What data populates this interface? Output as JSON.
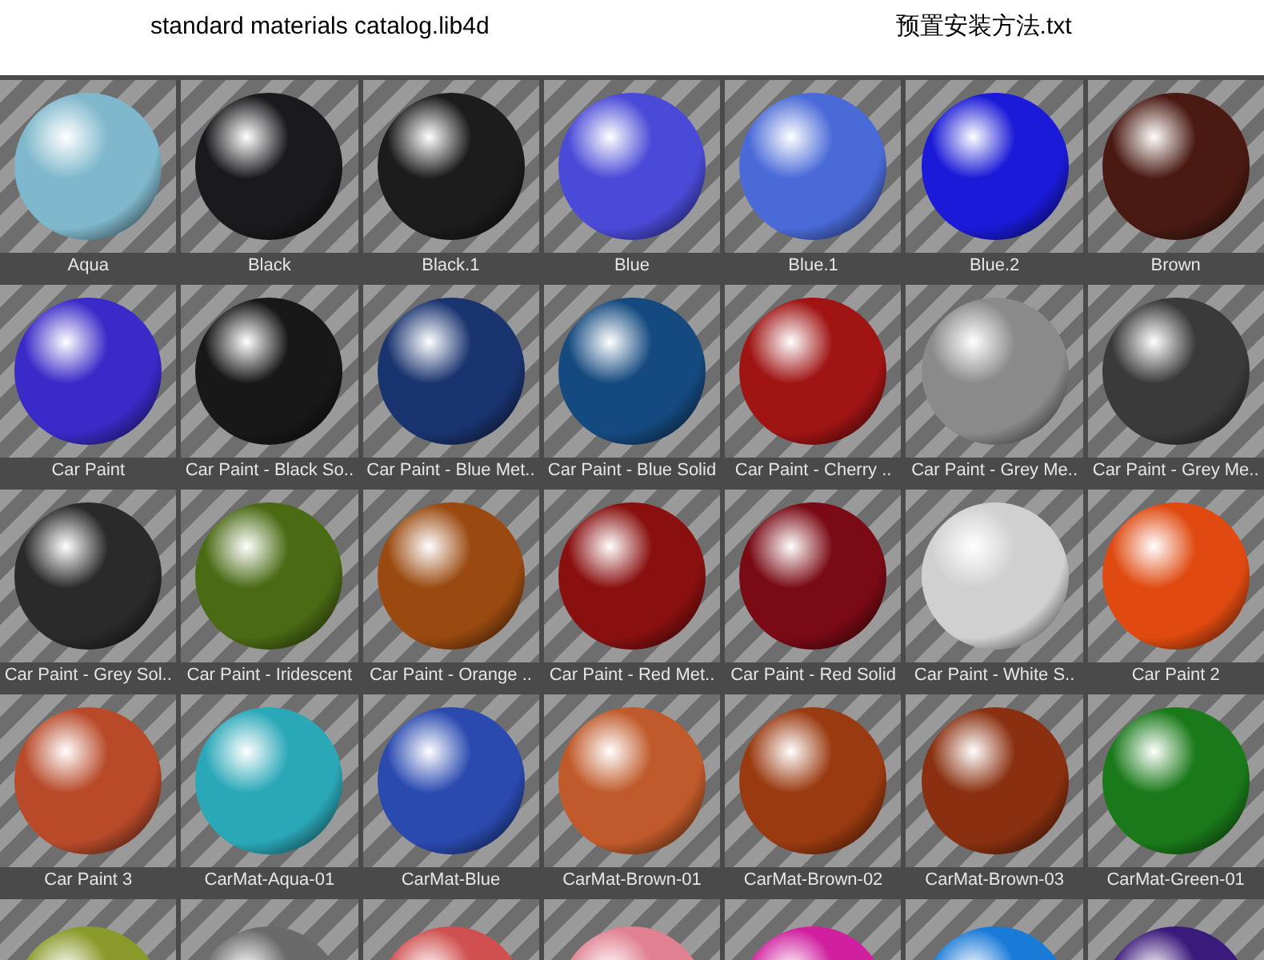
{
  "files": [
    {
      "name": "standard materials catalog.lib4d"
    },
    {
      "name": "预置安装方法.txt"
    }
  ],
  "materials": [
    {
      "name": "Aqua",
      "color": "#7fb8cc"
    },
    {
      "name": "Black",
      "color": "#1a1a1e"
    },
    {
      "name": "Black.1",
      "color": "#1c1c1c"
    },
    {
      "name": "Blue",
      "color": "#4a4ad8"
    },
    {
      "name": "Blue.1",
      "color": "#4a6ad8"
    },
    {
      "name": "Blue.2",
      "color": "#1a1ad8"
    },
    {
      "name": "Brown",
      "color": "#4a1a12"
    },
    {
      "name": "Car Paint",
      "color": "#3a2ac8"
    },
    {
      "name": "Car Paint - Black So..",
      "color": "#181818"
    },
    {
      "name": "Car Paint - Blue Met..",
      "color": "#1a3470"
    },
    {
      "name": "Car Paint - Blue Solid",
      "color": "#154a80"
    },
    {
      "name": "Car Paint - Cherry ..",
      "color": "#a01414"
    },
    {
      "name": "Car Paint - Grey Me..",
      "color": "#8a8a8a"
    },
    {
      "name": "Car Paint - Grey Me..",
      "color": "#3a3a3a"
    },
    {
      "name": "Car Paint - Grey Sol..",
      "color": "#2a2a2a"
    },
    {
      "name": "Car Paint - Iridescent",
      "color": "#4a6a14"
    },
    {
      "name": "Car Paint - Orange ..",
      "color": "#9a4a10"
    },
    {
      "name": "Car Paint - Red Met..",
      "color": "#8a1010"
    },
    {
      "name": "Car Paint - Red Solid",
      "color": "#7a0a14"
    },
    {
      "name": "Car Paint - White S..",
      "color": "#d0d0d0"
    },
    {
      "name": "Car Paint 2",
      "color": "#e04a10"
    },
    {
      "name": "Car Paint 3",
      "color": "#b84a2a"
    },
    {
      "name": "CarMat-Aqua-01",
      "color": "#2aa8b8"
    },
    {
      "name": "CarMat-Blue",
      "color": "#2a4ab0"
    },
    {
      "name": "CarMat-Brown-01",
      "color": "#c05a2a"
    },
    {
      "name": "CarMat-Brown-02",
      "color": "#9a3a10"
    },
    {
      "name": "CarMat-Brown-03",
      "color": "#8a3010"
    },
    {
      "name": "CarMat-Green-01",
      "color": "#1a7a1a"
    },
    {
      "color": "#8a9a2a"
    },
    {
      "color": "#6a6a6a"
    },
    {
      "color": "#d05050"
    },
    {
      "color": "#e08090"
    },
    {
      "color": "#d020a0"
    },
    {
      "color": "#1a7ad8"
    },
    {
      "color": "#3a1a7a"
    }
  ]
}
